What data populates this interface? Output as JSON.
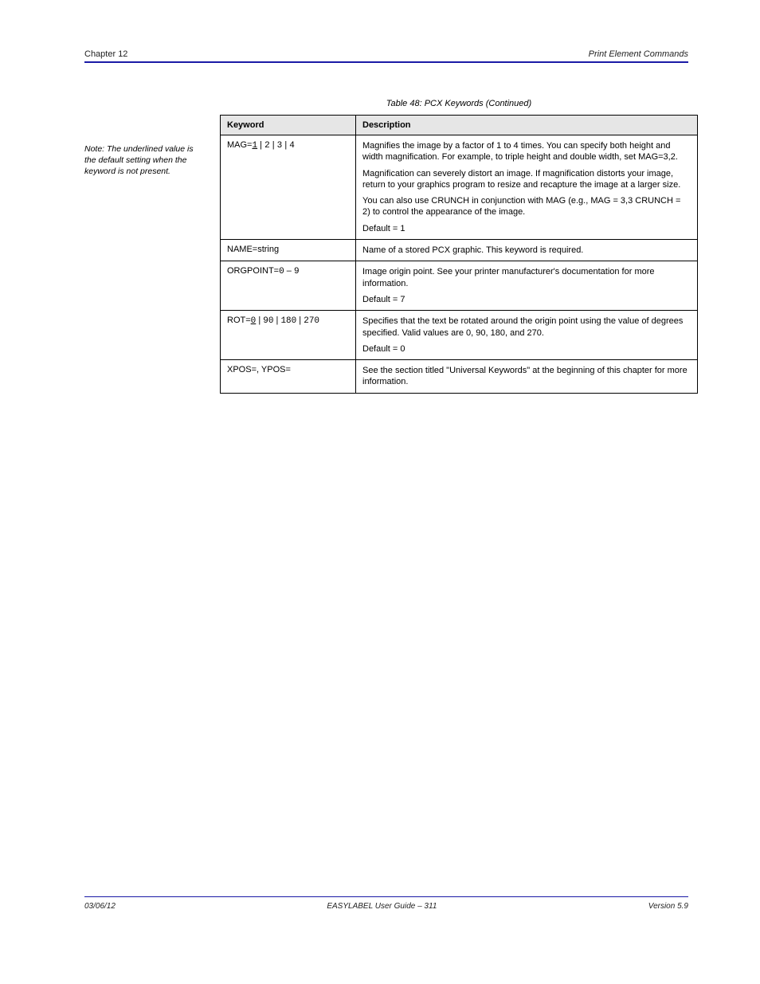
{
  "header": {
    "left": "Chapter 12",
    "right": "Print Element Commands"
  },
  "sidebar_note": "Note: The underlined value is the default setting when the keyword is not present.",
  "table": {
    "caption": "Table 48: PCX Keywords (Continued)",
    "col1": "Keyword",
    "col2": "Description",
    "rows": [
      {
        "keyword_html": "MAG=<span class='mono'><u>1</u></span> | <span class='mono'>2</span> | <span class='mono'>3</span> | <span class='mono'>4</span>",
        "desc_paras": [
          "Magnifies the image by a factor of 1 to 4 times. You can specify both height and width magnification. For example, to triple height and double width, set MAG=3,2.",
          "Magnification can severely distort an image. If magnification distorts your image, return to your graphics program to resize and recapture the image at a larger size.",
          "You can also use CRUNCH in conjunction with MAG (e.g., MAG = 3,3 CRUNCH = 2) to control the appearance of the image.",
          "Default = 1"
        ]
      },
      {
        "keyword_html": "NAME=string",
        "desc_paras": [
          "Name of a stored PCX graphic. This keyword is required."
        ]
      },
      {
        "keyword_html": "ORGPOINT=<span class='mono'>0</span> – <span class='mono'>9</span>",
        "desc_paras": [
          "Image origin point. See your printer manufacturer's documentation for more information.",
          "Default = 7"
        ]
      },
      {
        "keyword_html": "ROT=<span class='mono'><u>0</u></span> | <span class='mono'>90</span> | <span class='mono'>180</span> | <span class='mono'>270</span>",
        "desc_paras": [
          "Specifies that the text be rotated around the origin point using the value of degrees specified. Valid values are 0, 90, 180, and 270.",
          "Default = 0"
        ]
      },
      {
        "keyword_html": "XPOS=, YPOS=",
        "desc_paras": [
          "See the section titled \"Universal Keywords\" at the beginning of this chapter for more information."
        ]
      }
    ]
  },
  "footer": {
    "left": "03/06/12",
    "center": "EASYLABEL User Guide – 311",
    "right": "Version 5.9"
  }
}
